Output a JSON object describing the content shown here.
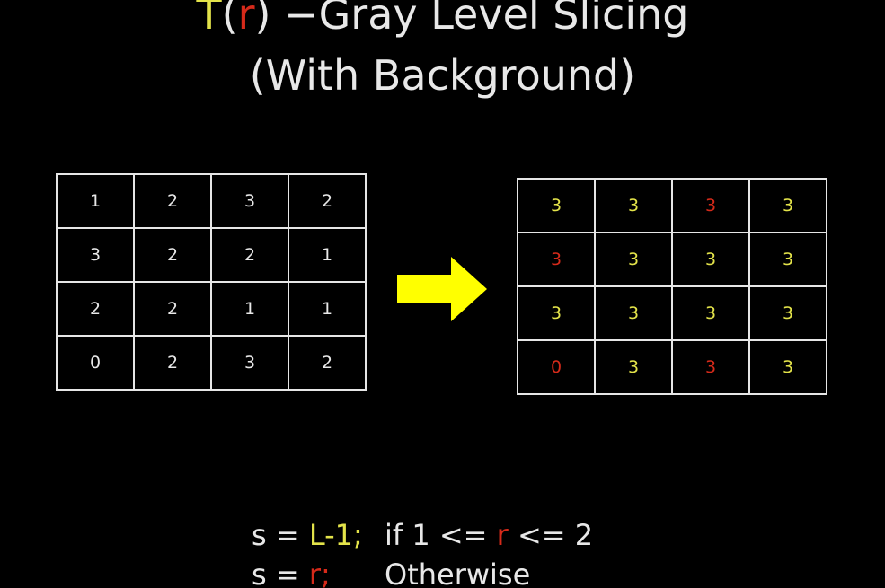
{
  "title": {
    "line1": {
      "t": "T",
      "open_paren": "(",
      "r": "r",
      "close_paren": ")",
      "rest": " −Gray Level Slicing"
    },
    "line2": "(With Background)"
  },
  "colors": {
    "background": "#000000",
    "text": "#e8e8e8",
    "highlight_yellow": "#e3e34a",
    "highlight_red": "#d62a1a",
    "arrow": "#ffff00"
  },
  "input_grid": [
    [
      "1",
      "2",
      "3",
      "2"
    ],
    [
      "3",
      "2",
      "2",
      "1"
    ],
    [
      "2",
      "2",
      "1",
      "1"
    ],
    [
      "0",
      "2",
      "3",
      "2"
    ]
  ],
  "output_grid": [
    [
      {
        "v": "3",
        "c": "yellow"
      },
      {
        "v": "3",
        "c": "yellow"
      },
      {
        "v": "3",
        "c": "red"
      },
      {
        "v": "3",
        "c": "yellow"
      }
    ],
    [
      {
        "v": "3",
        "c": "red"
      },
      {
        "v": "3",
        "c": "yellow"
      },
      {
        "v": "3",
        "c": "yellow"
      },
      {
        "v": "3",
        "c": "yellow"
      }
    ],
    [
      {
        "v": "3",
        "c": "yellow"
      },
      {
        "v": "3",
        "c": "yellow"
      },
      {
        "v": "3",
        "c": "yellow"
      },
      {
        "v": "3",
        "c": "yellow"
      }
    ],
    [
      {
        "v": "0",
        "c": "red"
      },
      {
        "v": "3",
        "c": "yellow"
      },
      {
        "v": "3",
        "c": "red"
      },
      {
        "v": "3",
        "c": "yellow"
      }
    ]
  ],
  "arrow_icon": "right-arrow-icon",
  "formula": {
    "line1": {
      "s_eq": "s = ",
      "value": "L-1;",
      "cond_a": "if 1 <= ",
      "r": "r",
      "cond_b": " <= 2"
    },
    "line2": {
      "s_eq": "s = ",
      "value": "r;",
      "cond": "Otherwise"
    }
  }
}
